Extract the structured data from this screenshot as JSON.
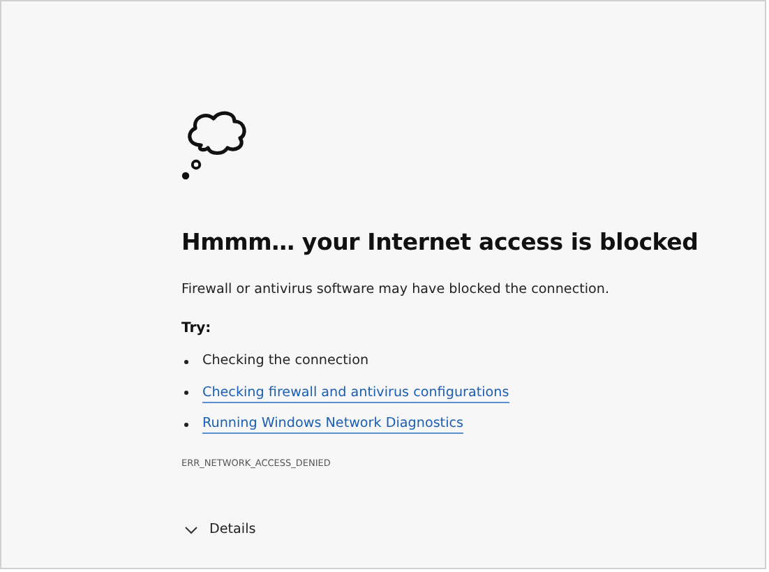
{
  "heading": "Hmmm… your Internet access is blocked",
  "message": "Firewall or antivirus software may have blocked the connection.",
  "try_label": "Try:",
  "suggestions": [
    {
      "kind": "text",
      "label": "Checking the connection"
    },
    {
      "kind": "link",
      "label": "Checking firewall and antivirus configurations"
    },
    {
      "kind": "link",
      "label": "Running Windows Network Diagnostics"
    }
  ],
  "error_code": "ERR_NETWORK_ACCESS_DENIED",
  "details": {
    "label": "Details",
    "expanded": false
  }
}
